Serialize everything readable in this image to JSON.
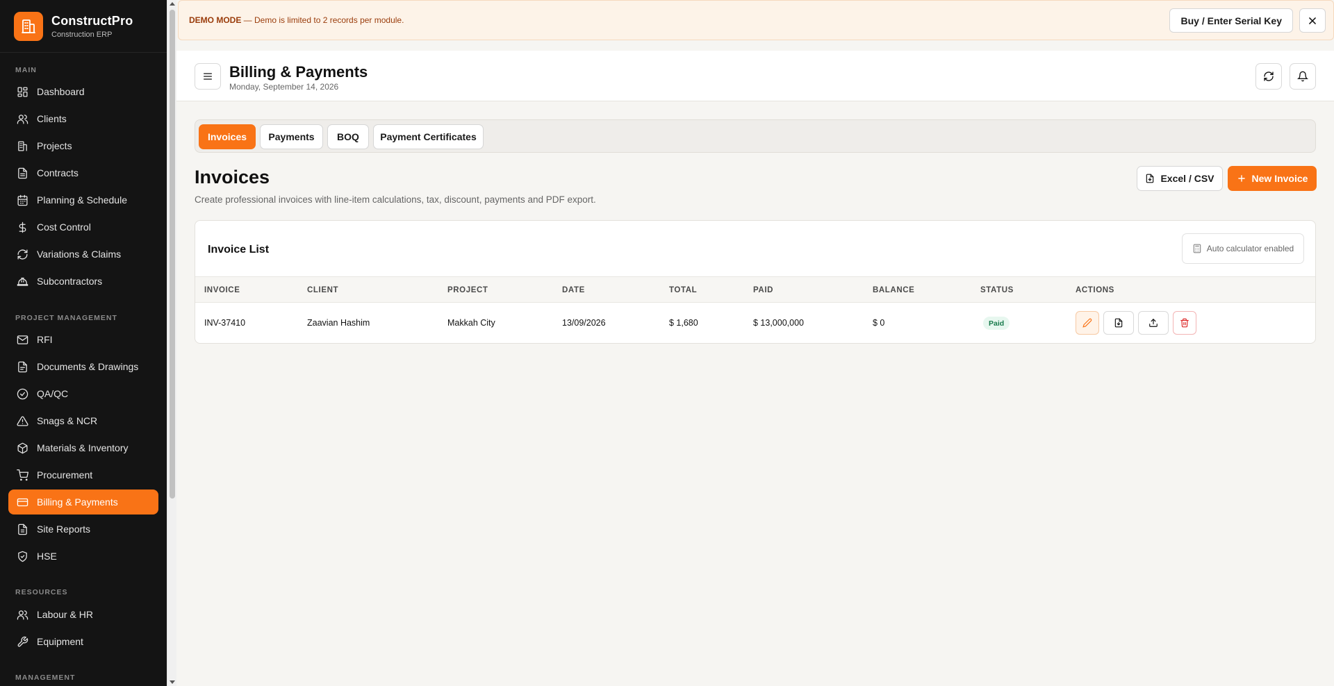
{
  "brand": {
    "name": "ConstructPro",
    "subtitle": "Construction ERP"
  },
  "sidebar": {
    "sections": {
      "main": "MAIN",
      "project_management": "PROJECT MANAGEMENT",
      "resources": "RESOURCES",
      "management": "MANAGEMENT"
    },
    "items": [
      {
        "label": "Dashboard",
        "icon": "dashboard-icon"
      },
      {
        "label": "Clients",
        "icon": "users-icon"
      },
      {
        "label": "Projects",
        "icon": "building-icon"
      },
      {
        "label": "Contracts",
        "icon": "document-icon"
      },
      {
        "label": "Planning & Schedule",
        "icon": "calendar-icon"
      },
      {
        "label": "Cost Control",
        "icon": "dollar-icon"
      },
      {
        "label": "Variations & Claims",
        "icon": "refresh-icon"
      },
      {
        "label": "Subcontractors",
        "icon": "helmet-icon"
      },
      {
        "label": "RFI",
        "icon": "mail-icon"
      },
      {
        "label": "Documents & Drawings",
        "icon": "file-icon"
      },
      {
        "label": "QA/QC",
        "icon": "check-circle-icon"
      },
      {
        "label": "Snags & NCR",
        "icon": "warning-icon"
      },
      {
        "label": "Materials & Inventory",
        "icon": "box-icon"
      },
      {
        "label": "Procurement",
        "icon": "cart-icon"
      },
      {
        "label": "Billing & Payments",
        "icon": "credit-card-icon",
        "active": true
      },
      {
        "label": "Site Reports",
        "icon": "report-icon"
      },
      {
        "label": "HSE",
        "icon": "shield-icon"
      },
      {
        "label": "Labour & HR",
        "icon": "users-icon"
      },
      {
        "label": "Equipment",
        "icon": "wrench-icon"
      }
    ]
  },
  "demo_banner": {
    "strong": "DEMO MODE",
    "text": " — Demo is limited to 2 records per module.",
    "serial_button": "Buy / Enter Serial Key"
  },
  "header": {
    "title": "Billing & Payments",
    "date": "Monday, September 14, 2026"
  },
  "tabs": [
    "Invoices",
    "Payments",
    "BOQ",
    "Payment Certificates"
  ],
  "active_tab": "Invoices",
  "section": {
    "title": "Invoices",
    "description": "Create professional invoices with line-item calculations, tax, discount, payments and PDF export.",
    "excel_button": "Excel / CSV",
    "new_button": "New Invoice"
  },
  "invoice_list": {
    "title": "Invoice List",
    "auto_calc": "Auto calculator enabled",
    "columns": [
      "INVOICE",
      "CLIENT",
      "PROJECT",
      "DATE",
      "TOTAL",
      "PAID",
      "BALANCE",
      "STATUS",
      "ACTIONS"
    ],
    "rows": [
      {
        "invoice": "INV-37410",
        "client": "Zaavian Hashim",
        "project": "Makkah City",
        "date": "13/09/2026",
        "total": "$ 1,680",
        "paid": "$ 13,000,000",
        "balance": "$ 0",
        "status": "Paid"
      }
    ]
  },
  "colors": {
    "accent": "#f97316",
    "sidebar_bg": "#141414",
    "status_paid_bg": "#e7f7ef",
    "status_paid_text": "#16794a",
    "danger": "#dc2626"
  }
}
